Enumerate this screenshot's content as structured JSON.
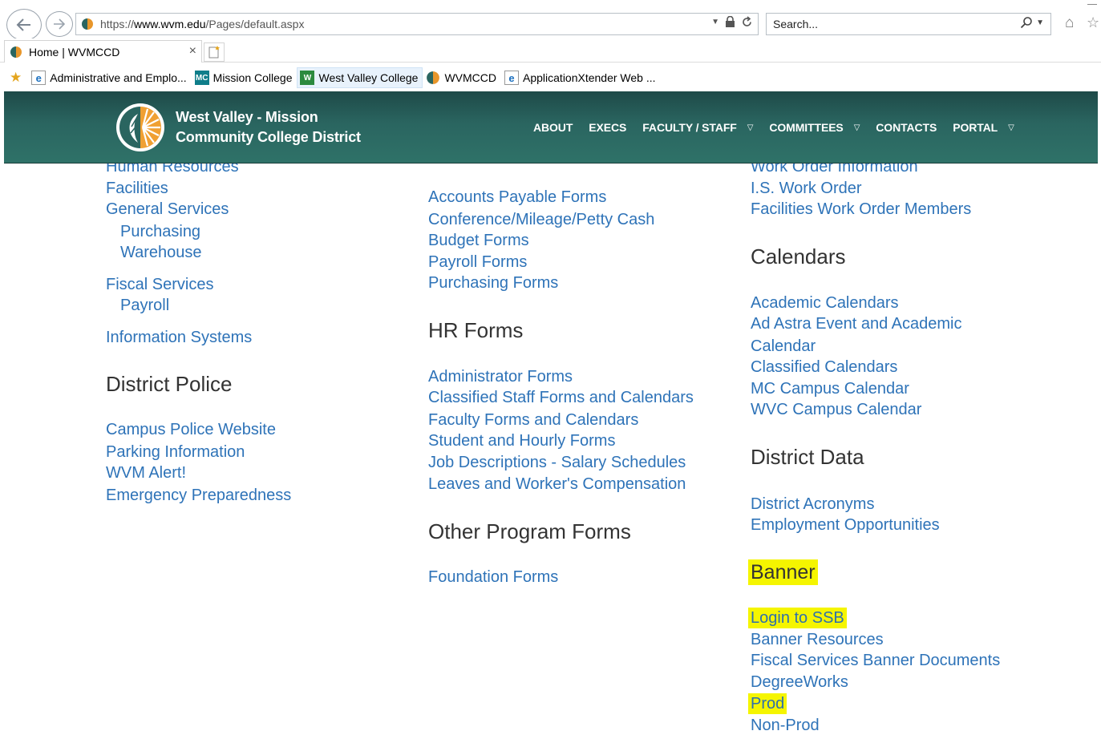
{
  "browser": {
    "url_scheme": "https://",
    "url_host": "www.wvm.edu",
    "url_path": "/Pages/default.aspx",
    "search_placeholder": "Search...",
    "tab_title": "Home | WVMCCD",
    "favorites": [
      {
        "label": "Administrative and Emplo..."
      },
      {
        "label": "Mission College"
      },
      {
        "label": "West Valley College"
      },
      {
        "label": "WVMCCD"
      },
      {
        "label": "ApplicationXtender Web ..."
      }
    ]
  },
  "header": {
    "site_name_line1": "West Valley - Mission",
    "site_name_line2": "Community College District",
    "nav": [
      {
        "label": "ABOUT"
      },
      {
        "label": "EXECS"
      },
      {
        "label": "FACULTY / STAFF"
      },
      {
        "label": "COMMITTEES"
      },
      {
        "label": "CONTACTS"
      },
      {
        "label": "PORTAL"
      }
    ],
    "colors": {
      "header_bg": "#2a6560",
      "link": "#2e73b8",
      "highlight": "#f5f500"
    }
  },
  "col1": {
    "link_human_resources": "Human Resources",
    "link_facilities": "Facilities",
    "link_general_services": "General Services",
    "link_purchasing": "Purchasing",
    "link_warehouse": "Warehouse",
    "link_fiscal_services": "Fiscal Services",
    "link_payroll": "Payroll",
    "link_information_systems": "Information Systems",
    "heading_district_police": "District Police",
    "link_campus_police": "Campus Police Website",
    "link_parking": "Parking Information",
    "link_wvm_alert": "WVM Alert!",
    "link_emergency": "Emergency Preparedness"
  },
  "col2": {
    "link_accounts_payable": "Accounts Payable Forms",
    "link_conference": "Conference/Mileage/Petty Cash",
    "link_budget": "Budget Forms",
    "link_payroll_forms": "Payroll Forms",
    "link_purchasing_forms": "Purchasing Forms",
    "heading_hr_forms": "HR Forms",
    "link_administrator": "Administrator Forms",
    "link_classified_staff": "Classified Staff Forms and Calendars",
    "link_faculty_forms": "Faculty Forms and Calendars",
    "link_student_hourly": "Student and Hourly Forms",
    "link_job_descriptions": "Job Descriptions - Salary Schedules",
    "link_leaves": "Leaves and Worker's Compensation",
    "heading_other_program": "Other Program Forms",
    "link_foundation": "Foundation Forms"
  },
  "col3": {
    "link_work_order_info": "Work Order Information",
    "link_is_work_order": "I.S. Work Order",
    "link_facilities_wo": "Facilities Work Order Members",
    "heading_calendars": "Calendars",
    "link_academic_cal": "Academic Calendars",
    "link_ad_astra_1": "Ad Astra Event and Academic",
    "link_ad_astra_2": "Calendar",
    "link_classified_cal": "Classified Calendars",
    "link_mc_campus": "MC Campus Calendar",
    "link_wvc_campus": "WVC Campus Calendar",
    "heading_district_data": "District Data",
    "link_acronyms": "District Acronyms",
    "link_employment": "Employment Opportunities",
    "heading_banner": "Banner",
    "link_login_ssb": "Login to SSB",
    "link_banner_resources": "Banner Resources",
    "link_fiscal_banner": "Fiscal Services Banner Documents",
    "link_degreeworks": "DegreeWorks",
    "link_prod": "Prod",
    "link_non_prod": "Non-Prod"
  }
}
